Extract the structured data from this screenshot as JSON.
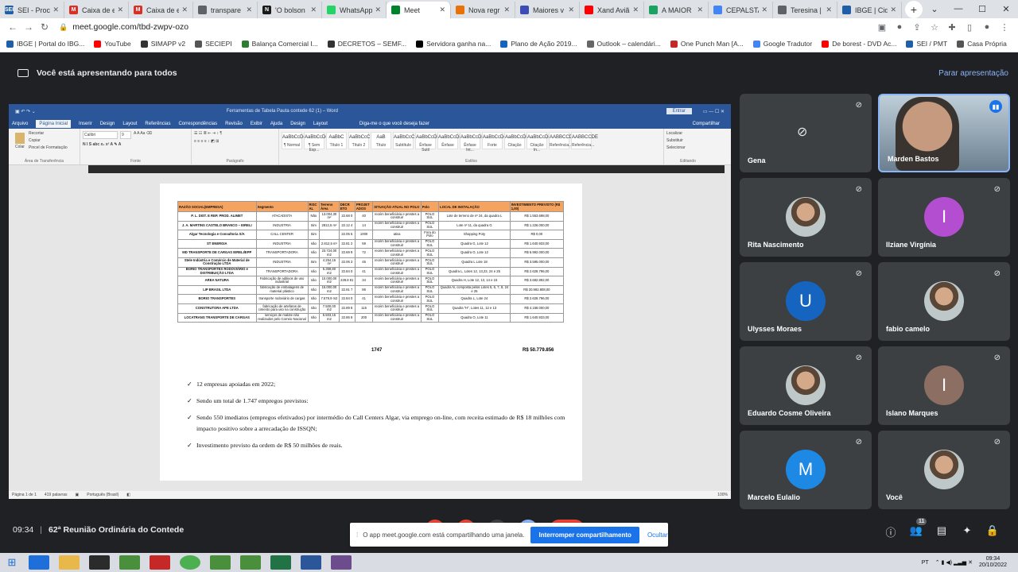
{
  "browser": {
    "tabs": [
      {
        "label": "SEI - Proc",
        "fav": "SEI",
        "color": "#1f5fa8"
      },
      {
        "label": "Caixa de e",
        "fav": "M",
        "color": "#d93025"
      },
      {
        "label": "Caixa de e",
        "fav": "M",
        "color": "#d93025"
      },
      {
        "label": "transpare",
        "fav": "",
        "color": "#5f6368"
      },
      {
        "label": "'O bolson",
        "fav": "N",
        "color": "#1a1a1a"
      },
      {
        "label": "WhatsApp",
        "fav": "",
        "color": "#25d366"
      },
      {
        "label": "Meet",
        "fav": "",
        "color": "#00832d",
        "active": true
      },
      {
        "label": "Nova regr",
        "fav": "",
        "color": "#e8710a"
      },
      {
        "label": "Maiores v",
        "fav": "",
        "color": "#3c4eb5"
      },
      {
        "label": "Xand Aviã",
        "fav": "",
        "color": "#ff0000"
      },
      {
        "label": "A MAIOR",
        "fav": "",
        "color": "#1aa260"
      },
      {
        "label": "CEPALSTA",
        "fav": "",
        "color": "#4285f4"
      },
      {
        "label": "Teresina |",
        "fav": "",
        "color": "#5f6368"
      },
      {
        "label": "IBGE | Cida",
        "fav": "",
        "color": "#1f5fa8"
      }
    ],
    "url": "meet.google.com/tbd-zwpv-ozo",
    "bookmarks": [
      {
        "label": "IBGE | Portal do IBG...",
        "color": "#1f5fa8"
      },
      {
        "label": "YouTube",
        "color": "#ff0000"
      },
      {
        "label": "SIMAPP v2",
        "color": "#333333"
      },
      {
        "label": "SECIEPI",
        "color": "#555555"
      },
      {
        "label": "Balança Comercial I...",
        "color": "#2e7d32"
      },
      {
        "label": "DECRETOS – SEMF...",
        "color": "#333333"
      },
      {
        "label": "Servidora ganha na...",
        "color": "#000000"
      },
      {
        "label": "Plano de Ação 2019...",
        "color": "#1565c0"
      },
      {
        "label": "Outlook – calendári...",
        "color": "#666666"
      },
      {
        "label": "One Punch Man [A...",
        "color": "#c62828"
      },
      {
        "label": "Google Tradutor",
        "color": "#4285f4"
      },
      {
        "label": "De borest - DVD Ac...",
        "color": "#ff0000"
      },
      {
        "label": "SEI / PMT",
        "color": "#1f5fa8"
      },
      {
        "label": "Casa Própria",
        "color": "#555555"
      }
    ]
  },
  "meet": {
    "presenting_text": "Você está apresentando para todos",
    "stop_presenting": "Parar apresentação",
    "meeting_time": "09:34",
    "meeting_title": "62ª Reunião Ordinária do Contede",
    "share_notice": "O app meet.google.com está compartilhando uma janela.",
    "stop_sharing": "Interromper compartilhamento",
    "hide": "Ocultar",
    "participant_count": "11",
    "participants": [
      {
        "name": "Gena",
        "type": "camoff"
      },
      {
        "name": "Marden Bastos",
        "type": "speaker"
      },
      {
        "name": "Rita Nascimento",
        "type": "photo"
      },
      {
        "name": "Ilziane Virgínia",
        "type": "letter",
        "letter": "I",
        "color": "#b34ed1"
      },
      {
        "name": "Ulysses Moraes",
        "type": "letter",
        "letter": "U",
        "color": "#1565c0"
      },
      {
        "name": "fabio camelo",
        "type": "photo"
      },
      {
        "name": "Eduardo Cosme Oliveira",
        "type": "photo"
      },
      {
        "name": "Islano Marques",
        "type": "letter",
        "letter": "I",
        "color": "#8d6e63"
      },
      {
        "name": "Marcelo Eulalio",
        "type": "letter",
        "letter": "M",
        "color": "#1e88e5"
      },
      {
        "name": "Você",
        "type": "photo"
      }
    ]
  },
  "word": {
    "title_center": "Ferramentas de Tabela    Pauta contede 62 (1) – Word",
    "signin": "Entrar",
    "menu": [
      "Arquivo",
      "Página Inicial",
      "Inserir",
      "Design",
      "Layout",
      "Referências",
      "Correspondências",
      "Revisão",
      "Exibir",
      "Ajuda",
      "Design",
      "Layout"
    ],
    "tell_me": "Diga-me o que você deseja fazer",
    "share": "Compartilhar",
    "font_name": "Calibri",
    "font_size": "9",
    "clipboard_items": [
      "Recortar",
      "Copiar",
      "Pincel de Formatação"
    ],
    "clipboard_label": "Área de Transferência",
    "paste": "Colar",
    "font_label": "Fonte",
    "para_label": "Parágrafo",
    "styles_label": "Estilos",
    "edit_label": "Editando",
    "edit_items": [
      "Localizar",
      "Substituir",
      "Selecionar"
    ],
    "styles": [
      {
        "sample": "AaBbCcDc",
        "name": "¶ Normal"
      },
      {
        "sample": "AaBbCcDc",
        "name": "¶ Sem Esp..."
      },
      {
        "sample": "AaBbC",
        "name": "Título 1"
      },
      {
        "sample": "AaBbCcC",
        "name": "Título 2"
      },
      {
        "sample": "AaB",
        "name": "Título"
      },
      {
        "sample": "AaBbCcC",
        "name": "Subtítulo"
      },
      {
        "sample": "AaBbCcDi",
        "name": "Ênfase Sutil"
      },
      {
        "sample": "AaBbCcDi",
        "name": "Ênfase"
      },
      {
        "sample": "AaBbCcDi",
        "name": "Ênfase Int..."
      },
      {
        "sample": "AaBbCcDc",
        "name": "Forte"
      },
      {
        "sample": "AaBbCcDi",
        "name": "Citação"
      },
      {
        "sample": "AaBbCcDi",
        "name": "Citação In..."
      },
      {
        "sample": "AABBCCDE",
        "name": "Referência..."
      },
      {
        "sample": "AABBCCDE",
        "name": "Referência..."
      }
    ],
    "status": {
      "page": "Página 1 de 1",
      "words": "419 palavras",
      "lang": "Português (Brasil)",
      "zoom": "100%"
    },
    "table": {
      "headers": [
        "RAZÃO SOCIAL(EMPRESA)",
        "Segmento",
        "RISC AL",
        "Terreno Área",
        "DECR ETO",
        "PROJET ADOS",
        "SITUAÇÃO ATUAL NO POLO",
        "Polo",
        "LOCAL DE INSTALAÇÃO",
        "INVESTIMENTO PREVISTO (R$ 1,00)"
      ],
      "rows": [
        [
          "P. L. DIST. E REP. PROD. ALIMET",
          "ATACADISTA",
          "Não",
          "13.004,30 m²",
          "22.68 0",
          "40",
          "recém beneficiária e prestes a construir",
          "POLO SUL",
          "Lote de terreno de nº 24, da quadra L",
          "R$ 1.553.698,00"
        ],
        [
          "J. A. MARTINS CASTELO BRANCO – EIRELI",
          "INDUSTRIA",
          "Sim",
          "2812,5 m²",
          "22.12 4",
          "14",
          "recém beneficiária e prestes a construir",
          "POLO SUL",
          "Lote nº 11, da quadra G",
          "R$ 1.226.000,00"
        ],
        [
          "Algar Tecnologia e Consultoria S/A",
          "CALL CENTER",
          "Sim",
          "",
          "22.05 5",
          "1000",
          "ativa",
          "Fora do Polo",
          "Shopping Poty",
          "R$ 0,00"
        ],
        [
          "ST ENERGIA",
          "INDUSTRIA",
          "não",
          "2.812,5 m²",
          "22.81 2",
          "59",
          "recém beneficiária e prestes a construir",
          "POLO SUL",
          "Quadra G, Lote 12",
          "R$ 1.640.933,00"
        ],
        [
          "MD TRANSPORTE DE CARGAS EIRELI/EPP",
          "TRANSPORTADORA",
          "não",
          "23.724,00 m2",
          "22.69 9",
          "72",
          "recém beneficiária e prestes a construir",
          "POLO SUL",
          "Quadra O, Lote 12",
          "R$ 6.992.000,00"
        ],
        [
          "Stele Indústria e Comércio de Material de Construção LTDA",
          "INDUSTRIA",
          "Sim",
          "4.254,16 m²",
          "22.06 3",
          "45",
          "recém beneficiária e prestes a construir",
          "POLO SUL",
          "Quadra L Lote 18",
          "R$ 3.595.000,00"
        ],
        [
          "BORIO TRANSPORTES RODOVIÁRIO e DISTRIBUIÇÃO LTDA",
          "TRANSPORTADORA",
          "não",
          "5.359,80 m2",
          "22.84 0",
          "41",
          "recém beneficiária e prestes a construir",
          "POLO SUL",
          "Quadra L, Lotes 12, 13,23, 24 e 25",
          "R$ 2.628.796,00"
        ],
        [
          "AREA NATURA",
          "Fabricação de aditivos de uso industrial",
          "não",
          "10.000,00 m2",
          "228.8 81",
          "34",
          "recém beneficiária e prestes a construir",
          "POLO SUL",
          "Quadra H, Lote 12, 13, 14 e 15",
          "R$ 3.682.892,00"
        ],
        [
          "LIP BRASIL LTDA",
          "fabricação de embalagens de material plástico",
          "não",
          "15.000,00 m2",
          "22.91 7",
          "86",
          "recém beneficiária e prestes a construir",
          "POLO SUL",
          "Quadra N, composta pelos Lotes 5, 6, 7, 8, 24 e 25",
          "R$ 20.992.808,00"
        ],
        [
          "BORIO TRANSPORTES",
          "transporte rodoviário de cargas",
          "não",
          "7.579,9 m2",
          "22.84 0",
          "41",
          "recém beneficiária e prestes a construir",
          "POLO SUL",
          "Quadra L, Lote 24",
          "R$ 2.628.796,00"
        ],
        [
          "CONSTRUTORA APE LTDA",
          "fabricação de artefatos de cimento para uso na construção",
          "não",
          "7.500,00 m2",
          "22.89 8",
          "115",
          "recém beneficiária e prestes a construir",
          "POLO SUL",
          "Quadra \"H\", Lotes 11, 12 e 13",
          "R$ 4.158.000,00"
        ],
        [
          "LOCATRANS TRANSPORTE DE CARGAS",
          "serviços de malote não realizados pelo Correio Nacional",
          "não",
          "5.503,15 m2",
          "22.86 8",
          "200",
          "recém beneficiária e prestes a construir",
          "POLO SUL",
          "Quadra O, Lote 11",
          "R$ 1.640.933,00"
        ]
      ],
      "total_jobs": "1747",
      "total_investment": "R$ 50.779.856"
    },
    "bullets": [
      "12 empresas apoiadas em 2022;",
      " Sendo um total de 1.747 empregos previstos:",
      "Sendo 550 imediatos (empregos efetivados) por intermédio do Call Centers Algar, via emprego on-line, com receita estimado de R$ 18 milhões com impacto positivo sobre a arrecadação de ISSQN;",
      "Investimento previsto da ordem de R$ 50 milhões de reais."
    ]
  },
  "taskbar": {
    "lang": "PT",
    "time": "09:34",
    "date": "20/10/2022"
  }
}
